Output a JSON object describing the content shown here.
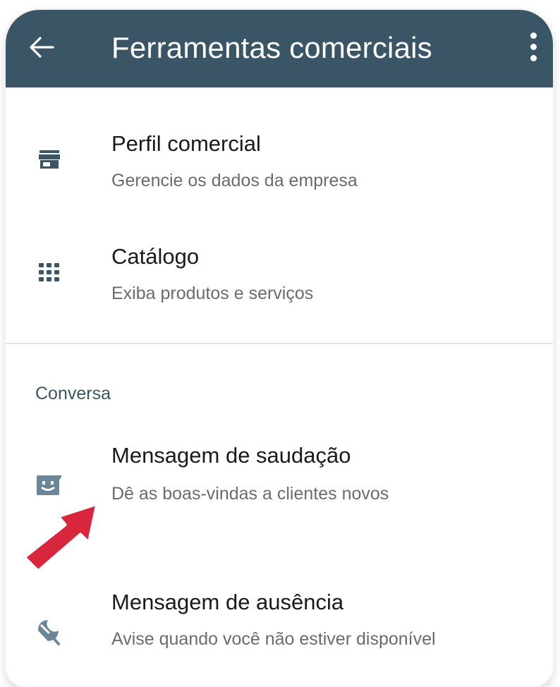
{
  "appbar": {
    "title": "Ferramentas comerciais",
    "back_icon": "arrow-left-icon",
    "menu_icon": "more-vert-icon",
    "color": "#3a5565"
  },
  "items": [
    {
      "title": "Perfil comercial",
      "subtitle": "Gerencie os dados da empresa",
      "icon": "storefront-icon"
    },
    {
      "title": "Catálogo",
      "subtitle": "Exiba produtos e serviços",
      "icon": "grid-icon"
    }
  ],
  "section": {
    "label": "Conversa"
  },
  "conversation_items": [
    {
      "title": "Mensagem de saudação",
      "subtitle": "Dê as boas-vindas a clientes novos",
      "icon": "greeting-icon"
    },
    {
      "title": "Mensagem de ausência",
      "subtitle": "Avise quando você não estiver disponível",
      "icon": "beach-umbrella-icon"
    }
  ],
  "annotation": {
    "icon": "red-pointer-arrow-icon",
    "color": "#d8263d"
  }
}
